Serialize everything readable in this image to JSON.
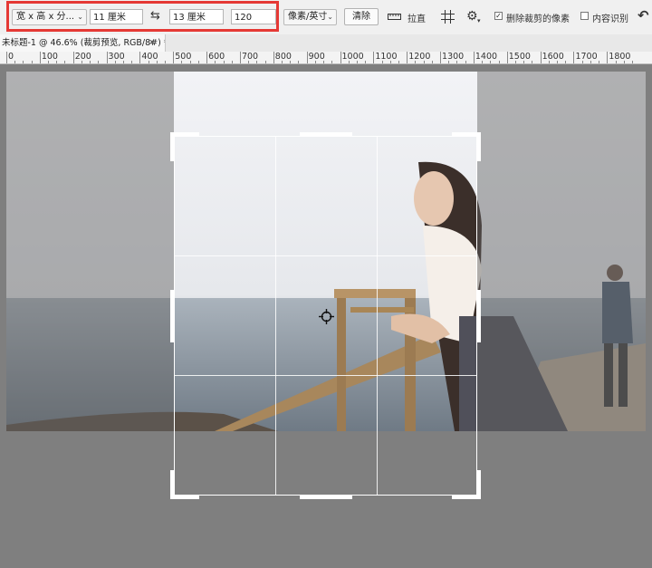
{
  "options_bar": {
    "ratio_preset": "宽 x 高 x 分...",
    "width_value": "11 厘米",
    "swap_icon": "swap-arrows-icon",
    "height_value": "13 厘米",
    "resolution_value": "120",
    "resolution_unit": "像素/英寸",
    "clear_label": "清除",
    "straighten_label": "拉直",
    "overlay_icon": "grid-overlay-icon",
    "settings_icon": "gear-icon",
    "delete_cropped_label": "删除裁剪的像素",
    "delete_cropped_checked": true,
    "content_aware_label": "内容识别",
    "content_aware_checked": false,
    "reset_icon": "reset-arrow-icon",
    "highlight_color": "#e53935"
  },
  "document_tab": {
    "title": "未标题-1 @ 46.6% (裁剪预览, RGB/8#) *",
    "close": "×"
  },
  "ruler": {
    "labels": [
      "0",
      "100",
      "200",
      "300",
      "400",
      "500",
      "600",
      "700",
      "800",
      "900",
      "1000",
      "1100",
      "1200",
      "1300",
      "1400",
      "1500",
      "1600",
      "1700",
      "1800"
    ]
  },
  "canvas": {
    "crop_grid": "rule-of-thirds",
    "pivot_icon": "crosshair-pivot-icon"
  }
}
